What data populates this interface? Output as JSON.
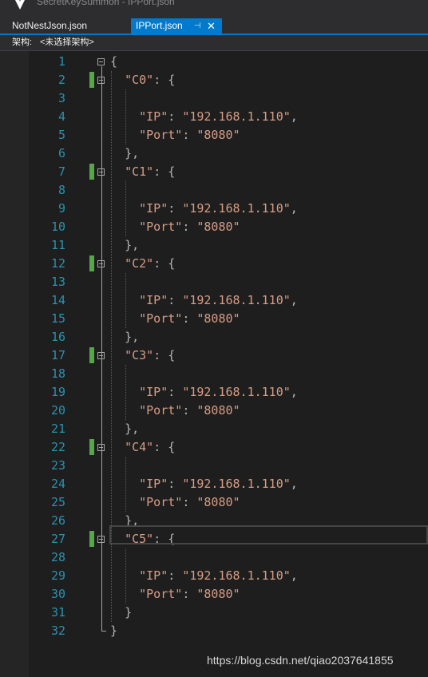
{
  "window": {
    "title": "SecretKeySummon - IPPort.json",
    "logo_icon": "visual-studio-logo"
  },
  "tabs": [
    {
      "label": "NotNestJson.json",
      "active": false
    },
    {
      "label": "IPPort.json",
      "active": true,
      "pin_icon": "pin-icon",
      "close_icon": "close-icon"
    }
  ],
  "structure_bar": {
    "label": "架构:",
    "value": "<未选择架构>"
  },
  "editor": {
    "current_line": 27,
    "lines": [
      {
        "n": "1",
        "text": "{"
      },
      {
        "n": "2",
        "text": "  \"C0\": {"
      },
      {
        "n": "3",
        "text": ""
      },
      {
        "n": "4",
        "text": "    \"IP\": \"192.168.1.110\","
      },
      {
        "n": "5",
        "text": "    \"Port\": \"8080\""
      },
      {
        "n": "6",
        "text": "  },"
      },
      {
        "n": "7",
        "text": "  \"C1\": {"
      },
      {
        "n": "8",
        "text": ""
      },
      {
        "n": "9",
        "text": "    \"IP\": \"192.168.1.110\","
      },
      {
        "n": "10",
        "text": "    \"Port\": \"8080\""
      },
      {
        "n": "11",
        "text": "  },"
      },
      {
        "n": "12",
        "text": "  \"C2\": {"
      },
      {
        "n": "13",
        "text": ""
      },
      {
        "n": "14",
        "text": "    \"IP\": \"192.168.1.110\","
      },
      {
        "n": "15",
        "text": "    \"Port\": \"8080\""
      },
      {
        "n": "16",
        "text": "  },"
      },
      {
        "n": "17",
        "text": "  \"C3\": {"
      },
      {
        "n": "18",
        "text": ""
      },
      {
        "n": "19",
        "text": "    \"IP\": \"192.168.1.110\","
      },
      {
        "n": "20",
        "text": "    \"Port\": \"8080\""
      },
      {
        "n": "21",
        "text": "  },"
      },
      {
        "n": "22",
        "text": "  \"C4\": {"
      },
      {
        "n": "23",
        "text": ""
      },
      {
        "n": "24",
        "text": "    \"IP\": \"192.168.1.110\","
      },
      {
        "n": "25",
        "text": "    \"Port\": \"8080\""
      },
      {
        "n": "26",
        "text": "  },"
      },
      {
        "n": "27",
        "text": "  \"C5\": {"
      },
      {
        "n": "28",
        "text": ""
      },
      {
        "n": "29",
        "text": "    \"IP\": \"192.168.1.110\","
      },
      {
        "n": "30",
        "text": "    \"Port\": \"8080\""
      },
      {
        "n": "31",
        "text": "  }"
      },
      {
        "n": "32",
        "text": "}"
      }
    ]
  },
  "colors": {
    "background": "#1e1e1e",
    "line_number": "#2b91af",
    "string": "#d69d85",
    "punctuation": "#b4b4b4",
    "tab_active": "#007acc",
    "change_marker": "#57a64a"
  },
  "watermark": "https://blog.csdn.net/qiao2037641855"
}
